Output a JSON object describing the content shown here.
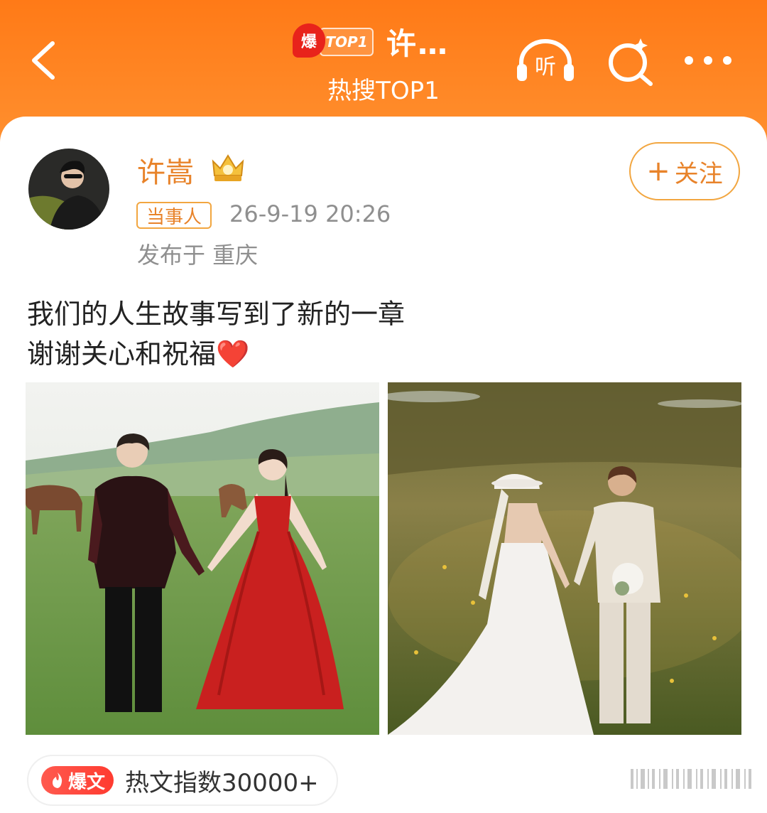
{
  "header": {
    "badge_bao": "爆",
    "badge_top": "TOP1",
    "title": "许…",
    "subtitle": "热搜TOP1",
    "listen_label": "听"
  },
  "post": {
    "username": "许嵩",
    "role_tag": "当事人",
    "time": "26-9-19 20:26",
    "location": "发布于 重庆",
    "follow_label": "关注",
    "follow_plus": "+",
    "text_line1": "我们的人生故事写到了新的一章",
    "text_line2": "谢谢关心和祝福",
    "heart": "❤️"
  },
  "hot_pill": {
    "badge": "爆文",
    "text": "热文指数30000+"
  },
  "colors": {
    "header_orange": "#ff7a17",
    "accent_orange": "#e8832a",
    "red_dress": "#c9201f",
    "grass_green": "#6f9a45"
  }
}
